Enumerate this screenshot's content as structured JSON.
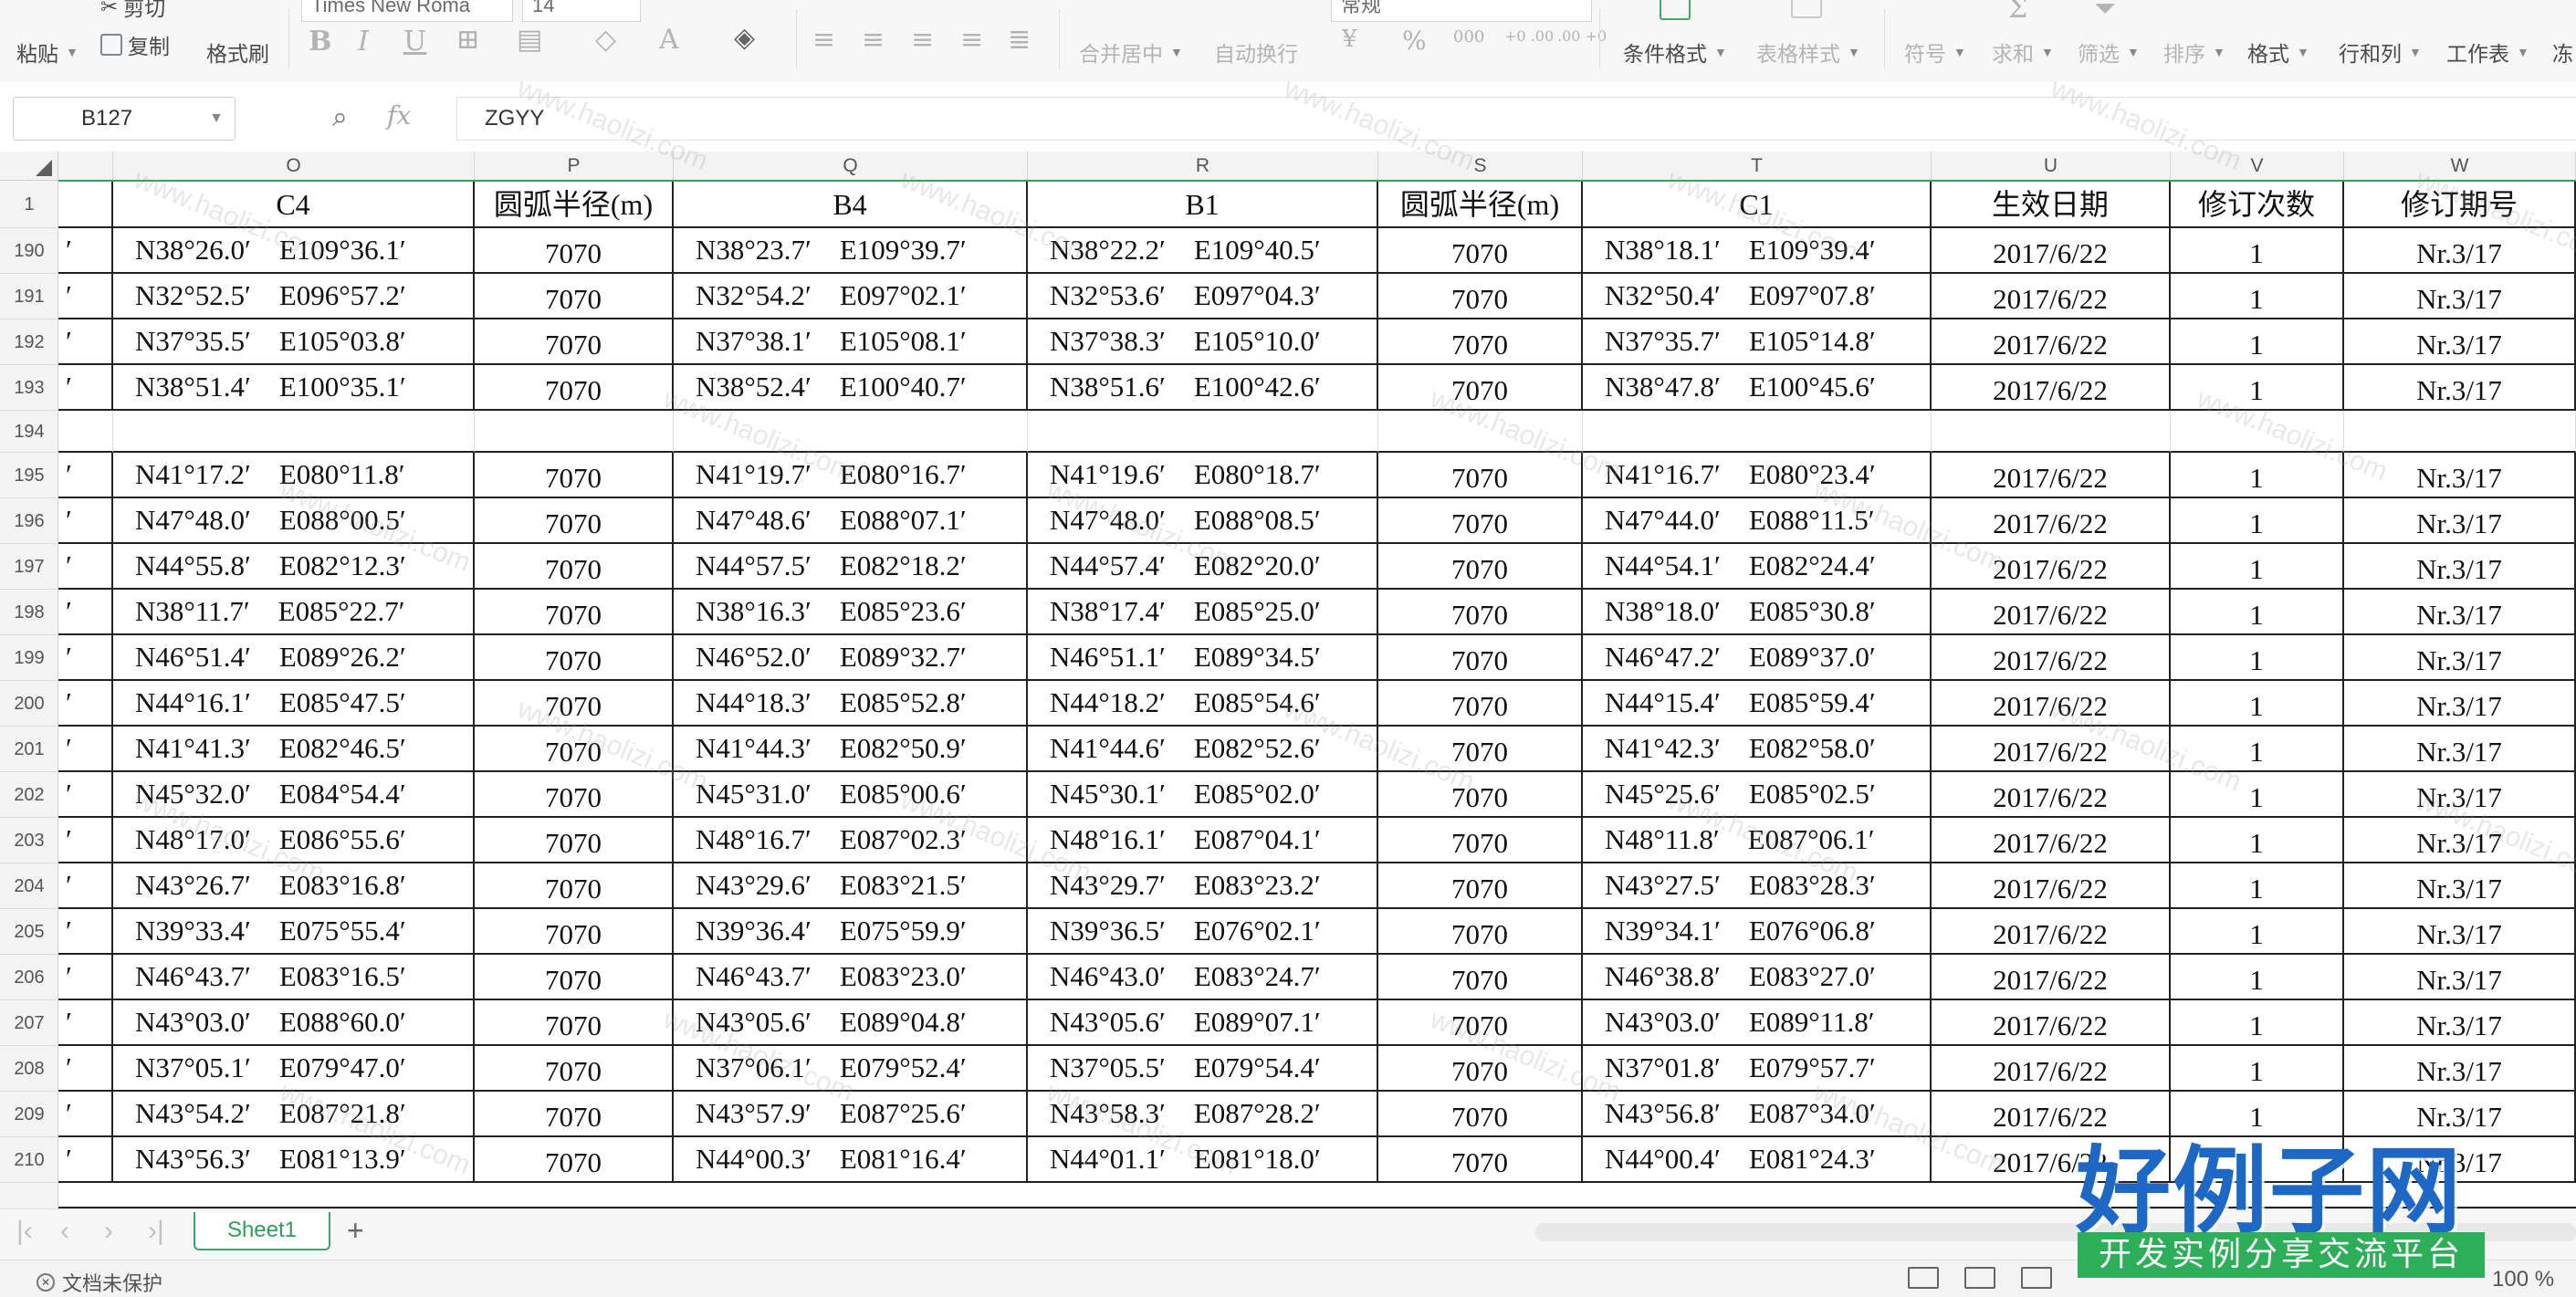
{
  "ribbon": {
    "paste": "粘贴",
    "cut": "剪切",
    "copy": "复制",
    "format_painter": "格式刷",
    "font_name": "Times New Roma",
    "font_size": "14",
    "merge_center": "合并居中",
    "auto_wrap": "自动换行",
    "number_format": "常规",
    "percent": "%",
    "thousands": "000",
    "inc_decimal": "+0 .00",
    "dec_decimal": ".00 +0",
    "conditional_format": "条件格式",
    "table_style": "表格样式",
    "symbol": "符号",
    "sum": "求和",
    "filter": "筛选",
    "sort": "排序",
    "format": "格式",
    "rows_cols": "行和列",
    "worksheet": "工作表",
    "freeze": "冻"
  },
  "formula_bar": {
    "cell_ref": "B127",
    "fx": "fx",
    "content": "ZGYY"
  },
  "columns": [
    {
      "letter": "",
      "header": ""
    },
    {
      "letter": "O",
      "header": "C4"
    },
    {
      "letter": "P",
      "header": "圆弧半径(m)"
    },
    {
      "letter": "Q",
      "header": "B4"
    },
    {
      "letter": "R",
      "header": "B1"
    },
    {
      "letter": "S",
      "header": "圆弧半径(m)"
    },
    {
      "letter": "T",
      "header": "C1"
    },
    {
      "letter": "U",
      "header": "生效日期"
    },
    {
      "letter": "V",
      "header": "修订次数"
    },
    {
      "letter": "W",
      "header": "修订期号"
    }
  ],
  "header_row_number": "1",
  "rows": [
    {
      "n": "190",
      "f": "′",
      "o": "N38°26.0′　E109°36.1′",
      "p": "7070",
      "q": "N38°23.7′　E109°39.7′",
      "r": "N38°22.2′　E109°40.5′",
      "s": "7070",
      "t": "N38°18.1′　E109°39.4′",
      "u": "2017/6/22",
      "v": "1",
      "w": "Nr.3/17"
    },
    {
      "n": "191",
      "f": "′",
      "o": "N32°52.5′　E096°57.2′",
      "p": "7070",
      "q": "N32°54.2′　E097°02.1′",
      "r": "N32°53.6′　E097°04.3′",
      "s": "7070",
      "t": "N32°50.4′　E097°07.8′",
      "u": "2017/6/22",
      "v": "1",
      "w": "Nr.3/17"
    },
    {
      "n": "192",
      "f": "′",
      "o": "N37°35.5′　E105°03.8′",
      "p": "7070",
      "q": "N37°38.1′　E105°08.1′",
      "r": "N37°38.3′　E105°10.0′",
      "s": "7070",
      "t": "N37°35.7′　E105°14.8′",
      "u": "2017/6/22",
      "v": "1",
      "w": "Nr.3/17"
    },
    {
      "n": "193",
      "f": "′",
      "o": "N38°51.4′　E100°35.1′",
      "p": "7070",
      "q": "N38°52.4′　E100°40.7′",
      "r": "N38°51.6′　E100°42.6′",
      "s": "7070",
      "t": "N38°47.8′　E100°45.6′",
      "u": "2017/6/22",
      "v": "1",
      "w": "Nr.3/17"
    },
    {
      "n": "194",
      "f": "",
      "o": "",
      "p": "",
      "q": "",
      "r": "",
      "s": "",
      "t": "",
      "u": "",
      "v": "",
      "w": ""
    },
    {
      "n": "195",
      "f": "′",
      "o": "N41°17.2′　E080°11.8′",
      "p": "7070",
      "q": "N41°19.7′　E080°16.7′",
      "r": "N41°19.6′　E080°18.7′",
      "s": "7070",
      "t": "N41°16.7′　E080°23.4′",
      "u": "2017/6/22",
      "v": "1",
      "w": "Nr.3/17"
    },
    {
      "n": "196",
      "f": "′",
      "o": "N47°48.0′　E088°00.5′",
      "p": "7070",
      "q": "N47°48.6′　E088°07.1′",
      "r": "N47°48.0′　E088°08.5′",
      "s": "7070",
      "t": "N47°44.0′　E088°11.5′",
      "u": "2017/6/22",
      "v": "1",
      "w": "Nr.3/17"
    },
    {
      "n": "197",
      "f": "′",
      "o": "N44°55.8′　E082°12.3′",
      "p": "7070",
      "q": "N44°57.5′　E082°18.2′",
      "r": "N44°57.4′　E082°20.0′",
      "s": "7070",
      "t": "N44°54.1′　E082°24.4′",
      "u": "2017/6/22",
      "v": "1",
      "w": "Nr.3/17"
    },
    {
      "n": "198",
      "f": "′",
      "o": "N38°11.7′　E085°22.7′",
      "p": "7070",
      "q": "N38°16.3′　E085°23.6′",
      "r": "N38°17.4′　E085°25.0′",
      "s": "7070",
      "t": "N38°18.0′　E085°30.8′",
      "u": "2017/6/22",
      "v": "1",
      "w": "Nr.3/17"
    },
    {
      "n": "199",
      "f": "′",
      "o": "N46°51.4′　E089°26.2′",
      "p": "7070",
      "q": "N46°52.0′　E089°32.7′",
      "r": "N46°51.1′　E089°34.5′",
      "s": "7070",
      "t": "N46°47.2′　E089°37.0′",
      "u": "2017/6/22",
      "v": "1",
      "w": "Nr.3/17"
    },
    {
      "n": "200",
      "f": "′",
      "o": "N44°16.1′　E085°47.5′",
      "p": "7070",
      "q": "N44°18.3′　E085°52.8′",
      "r": "N44°18.2′　E085°54.6′",
      "s": "7070",
      "t": "N44°15.4′　E085°59.4′",
      "u": "2017/6/22",
      "v": "1",
      "w": "Nr.3/17"
    },
    {
      "n": "201",
      "f": "′",
      "o": "N41°41.3′　E082°46.5′",
      "p": "7070",
      "q": "N41°44.3′　E082°50.9′",
      "r": "N41°44.6′　E082°52.6′",
      "s": "7070",
      "t": "N41°42.3′　E082°58.0′",
      "u": "2017/6/22",
      "v": "1",
      "w": "Nr.3/17"
    },
    {
      "n": "202",
      "f": "′",
      "o": "N45°32.0′　E084°54.4′",
      "p": "7070",
      "q": "N45°31.0′　E085°00.6′",
      "r": "N45°30.1′　E085°02.0′",
      "s": "7070",
      "t": "N45°25.6′　E085°02.5′",
      "u": "2017/6/22",
      "v": "1",
      "w": "Nr.3/17"
    },
    {
      "n": "203",
      "f": "′",
      "o": "N48°17.0′　E086°55.6′",
      "p": "7070",
      "q": "N48°16.7′　E087°02.3′",
      "r": "N48°16.1′　E087°04.1′",
      "s": "7070",
      "t": "N48°11.8′　E087°06.1′",
      "u": "2017/6/22",
      "v": "1",
      "w": "Nr.3/17"
    },
    {
      "n": "204",
      "f": "′",
      "o": "N43°26.7′　E083°16.8′",
      "p": "7070",
      "q": "N43°29.6′　E083°21.5′",
      "r": "N43°29.7′　E083°23.2′",
      "s": "7070",
      "t": "N43°27.5′　E083°28.3′",
      "u": "2017/6/22",
      "v": "1",
      "w": "Nr.3/17"
    },
    {
      "n": "205",
      "f": "′",
      "o": "N39°33.4′　E075°55.4′",
      "p": "7070",
      "q": "N39°36.4′　E075°59.9′",
      "r": "N39°36.5′　E076°02.1′",
      "s": "7070",
      "t": "N39°34.1′　E076°06.8′",
      "u": "2017/6/22",
      "v": "1",
      "w": "Nr.3/17"
    },
    {
      "n": "206",
      "f": "′",
      "o": "N46°43.7′　E083°16.5′",
      "p": "7070",
      "q": "N46°43.7′　E083°23.0′",
      "r": "N46°43.0′　E083°24.7′",
      "s": "7070",
      "t": "N46°38.8′　E083°27.0′",
      "u": "2017/6/22",
      "v": "1",
      "w": "Nr.3/17"
    },
    {
      "n": "207",
      "f": "′",
      "o": "N43°03.0′　E088°60.0′",
      "p": "7070",
      "q": "N43°05.6′　E089°04.8′",
      "r": "N43°05.6′　E089°07.1′",
      "s": "7070",
      "t": "N43°03.0′　E089°11.8′",
      "u": "2017/6/22",
      "v": "1",
      "w": "Nr.3/17"
    },
    {
      "n": "208",
      "f": "′",
      "o": "N37°05.1′　E079°47.0′",
      "p": "7070",
      "q": "N37°06.1′　E079°52.4′",
      "r": "N37°05.5′　E079°54.4′",
      "s": "7070",
      "t": "N37°01.8′　E079°57.7′",
      "u": "2017/6/22",
      "v": "1",
      "w": "Nr.3/17"
    },
    {
      "n": "209",
      "f": "′",
      "o": "N43°54.2′　E087°21.8′",
      "p": "7070",
      "q": "N43°57.9′　E087°25.6′",
      "r": "N43°58.3′　E087°28.2′",
      "s": "7070",
      "t": "N43°56.8′　E087°34.0′",
      "u": "2017/6/22",
      "v": "1",
      "w": "Nr.3/17"
    },
    {
      "n": "210",
      "f": "′",
      "o": "N43°56.3′　E081°13.9′",
      "p": "7070",
      "q": "N44°00.3′　E081°16.4′",
      "r": "N44°01.1′　E081°18.0′",
      "s": "7070",
      "t": "N44°00.4′　E081°24.3′",
      "u": "2017/6/22",
      "v": "1",
      "w": "Nr.3/17"
    }
  ],
  "sheet_tabs": {
    "active": "Sheet1",
    "add": "+"
  },
  "status_bar": {
    "protection": "文档未保护",
    "zoom": "100 %"
  },
  "watermark": "www.haolizi.com",
  "logo": {
    "title": "好例子网",
    "subtitle": "开发实例分享交流平台"
  }
}
